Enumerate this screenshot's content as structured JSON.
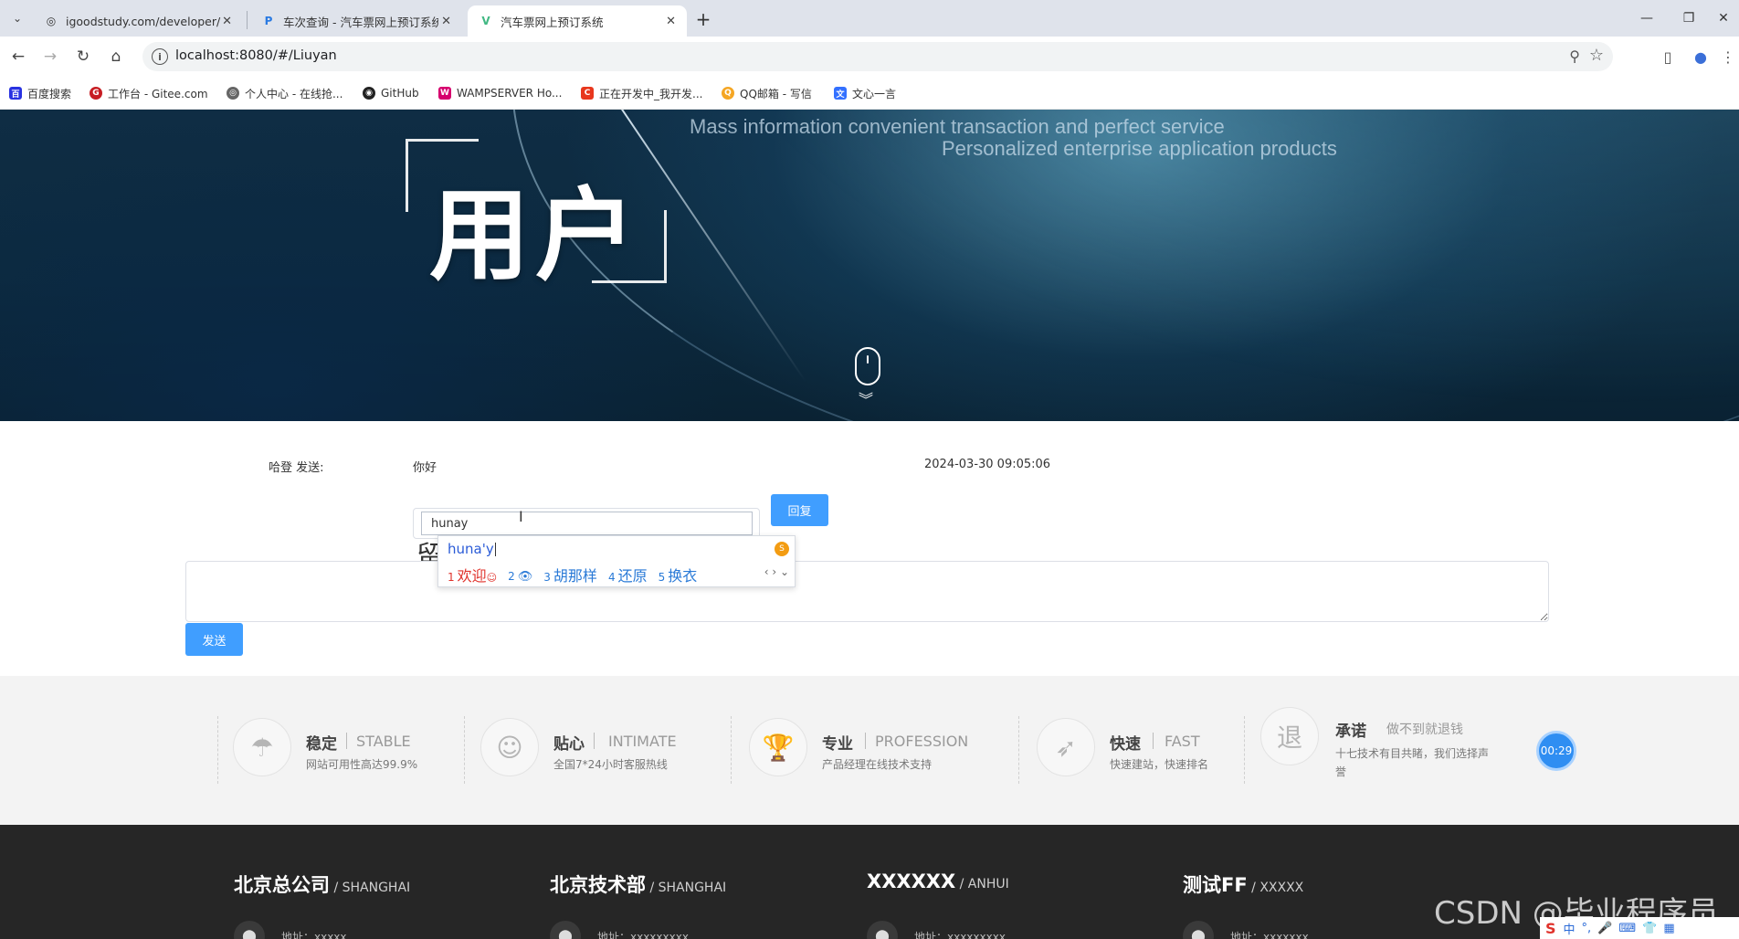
{
  "browser": {
    "tabs": [
      {
        "title": "igoodstudy.com/developer/",
        "icon": "globe-icon"
      },
      {
        "title": "车次查询 - 汽车票网上预订系统",
        "icon": "p-logo-icon"
      },
      {
        "title": "汽车票网上预订系统",
        "icon": "vue-logo-icon"
      }
    ],
    "url": "localhost:8080/#/Liuyan",
    "bookmarks": [
      {
        "label": "百度搜索",
        "color": "#2932e1"
      },
      {
        "label": "工作台 - Gitee.com",
        "color": "#c71d23"
      },
      {
        "label": "个人中心 - 在线抢...",
        "color": "#666666"
      },
      {
        "label": "GitHub",
        "color": "#222222"
      },
      {
        "label": "WAMPSERVER Ho...",
        "color": "#d6006e"
      },
      {
        "label": "正在开发中_我开发...",
        "color": "#e8371d"
      },
      {
        "label": "QQ邮箱 - 写信",
        "color": "#f5a623"
      },
      {
        "label": "文心一言",
        "color": "#3370ff"
      }
    ]
  },
  "hero": {
    "title": "用户",
    "tagline1": "Mass information convenient transaction and perfect service",
    "tagline2": "Personalized enterprise application products"
  },
  "message": {
    "sender": "哈登 发送:",
    "content": "你好",
    "time": "2024-03-30 09:05:06",
    "reply_value": "hunay",
    "reply_button": "回复"
  },
  "ime": {
    "composition": "huna'y",
    "candidates": [
      {
        "num": "1",
        "text": "欢迎"
      },
      {
        "num": "2",
        "text": ""
      },
      {
        "num": "3",
        "text": "胡那样"
      },
      {
        "num": "4",
        "text": "还原"
      },
      {
        "num": "5",
        "text": "换衣"
      }
    ]
  },
  "form": {
    "label": "留",
    "send_button": "发送"
  },
  "features": [
    {
      "cn": "稳定",
      "en": "STABLE",
      "desc": "网站可用性高达99.9%",
      "icon": "umbrella-icon"
    },
    {
      "cn": "贴心",
      "en": "INTIMATE",
      "desc": "全国7*24小时客服热线",
      "icon": "smile-icon"
    },
    {
      "cn": "专业",
      "en": "PROFESSION",
      "desc": "产品经理在线技术支持",
      "icon": "trophy-icon"
    },
    {
      "cn": "快速",
      "en": "FAST",
      "desc": "快速建站，快速排名",
      "icon": "rocket-icon"
    },
    {
      "cn": "承诺",
      "en": "做不到就退钱",
      "desc": "十七技术有目共睹，我们选择声",
      "desc2": "誉",
      "icon": "refund-icon",
      "icon_text": "退"
    }
  ],
  "timer": "00:29",
  "footer": [
    {
      "cn": "北京总公司",
      "en": " / SHANGHAI",
      "addr": "地址：xxxxx"
    },
    {
      "cn": "北京技术部",
      "en": " / SHANGHAI",
      "addr": "地址：xxxxxxxxx"
    },
    {
      "cn": "XXXXXX",
      "en": " / ANHUI",
      "addr": "地址：xxxxxxxxx"
    },
    {
      "cn": "测试FF",
      "en": " / XXXXX",
      "addr": "地址：xxxxxxx"
    }
  ],
  "watermark": "CSDN @毕业程序员",
  "ime_tray": "中"
}
